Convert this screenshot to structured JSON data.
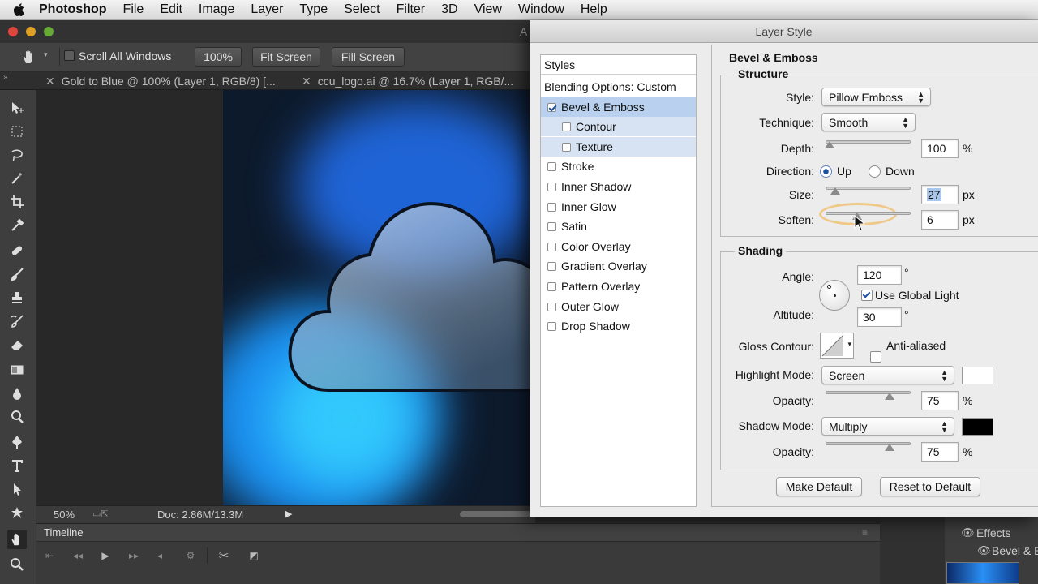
{
  "menubar": {
    "app": "Photoshop",
    "items": [
      "File",
      "Edit",
      "Image",
      "Layer",
      "Type",
      "Select",
      "Filter",
      "3D",
      "View",
      "Window",
      "Help"
    ]
  },
  "window": {
    "title_fragment": "A"
  },
  "options_bar": {
    "scroll_all_windows": "Scroll All Windows",
    "zoom_value": "100%",
    "fit_screen": "Fit Screen",
    "fill_screen": "Fill Screen"
  },
  "doc_tabs": [
    {
      "label": "Gold to Blue @ 100% (Layer 1, RGB/8) [..."
    },
    {
      "label": "ccu_logo.ai @ 16.7% (Layer 1, RGB/..."
    }
  ],
  "tools": [
    "move-tool",
    "marquee-tool",
    "lasso-tool",
    "magic-wand-tool",
    "crop-tool",
    "eyedropper-tool",
    "healing-brush-tool",
    "brush-tool",
    "clone-stamp-tool",
    "history-brush-tool",
    "eraser-tool",
    "gradient-tool",
    "blur-tool",
    "dodge-tool",
    "pen-tool",
    "type-tool",
    "path-selection-tool",
    "shape-tool",
    "hand-tool",
    "zoom-tool"
  ],
  "status": {
    "zoom": "50%",
    "doc": "Doc: 2.86M/13.3M"
  },
  "timeline": {
    "title": "Timeline"
  },
  "layers_panel": {
    "effects": "Effects",
    "bevel": "Bevel & E"
  },
  "dialog": {
    "title": "Layer Style",
    "styles_header": "Styles",
    "blending_options": "Blending Options: Custom",
    "style_items": [
      {
        "label": "Bevel & Emboss",
        "checked": true
      },
      {
        "label": "Contour",
        "checked": false
      },
      {
        "label": "Texture",
        "checked": false
      },
      {
        "label": "Stroke",
        "checked": false
      },
      {
        "label": "Inner Shadow",
        "checked": false
      },
      {
        "label": "Inner Glow",
        "checked": false
      },
      {
        "label": "Satin",
        "checked": false
      },
      {
        "label": "Color Overlay",
        "checked": false
      },
      {
        "label": "Gradient Overlay",
        "checked": false
      },
      {
        "label": "Pattern Overlay",
        "checked": false
      },
      {
        "label": "Outer Glow",
        "checked": false
      },
      {
        "label": "Drop Shadow",
        "checked": false
      }
    ],
    "section_title": "Bevel & Emboss",
    "structure": {
      "title": "Structure",
      "style_label": "Style:",
      "style_value": "Pillow Emboss",
      "technique_label": "Technique:",
      "technique_value": "Smooth",
      "depth_label": "Depth:",
      "depth_value": "100",
      "depth_unit": "%",
      "depth_level": 0.05,
      "direction_label": "Direction:",
      "direction_up": "Up",
      "direction_down": "Down",
      "direction_selected": "Up",
      "size_label": "Size:",
      "size_value": "27",
      "size_unit": "px",
      "size_level": 0.11,
      "soften_label": "Soften:",
      "soften_value": "6",
      "soften_unit": "px",
      "soften_level": 0.37
    },
    "shading": {
      "title": "Shading",
      "angle_label": "Angle:",
      "angle_value": "120",
      "degree": "°",
      "use_global_light": "Use Global Light",
      "use_global_light_checked": true,
      "altitude_label": "Altitude:",
      "altitude_value": "30",
      "gloss_contour_label": "Gloss Contour:",
      "anti_aliased": "Anti-aliased",
      "anti_aliased_checked": false,
      "highlight_mode_label": "Highlight Mode:",
      "highlight_mode_value": "Screen",
      "highlight_color": "#ffffff",
      "opacity_label": "Opacity:",
      "highlight_opacity": "75",
      "highlight_opacity_level": 0.75,
      "shadow_mode_label": "Shadow Mode:",
      "shadow_mode_value": "Multiply",
      "shadow_color": "#000000",
      "shadow_opacity": "75",
      "shadow_opacity_level": 0.75,
      "percent": "%"
    },
    "make_default": "Make Default",
    "reset_to_default": "Reset to Default"
  }
}
